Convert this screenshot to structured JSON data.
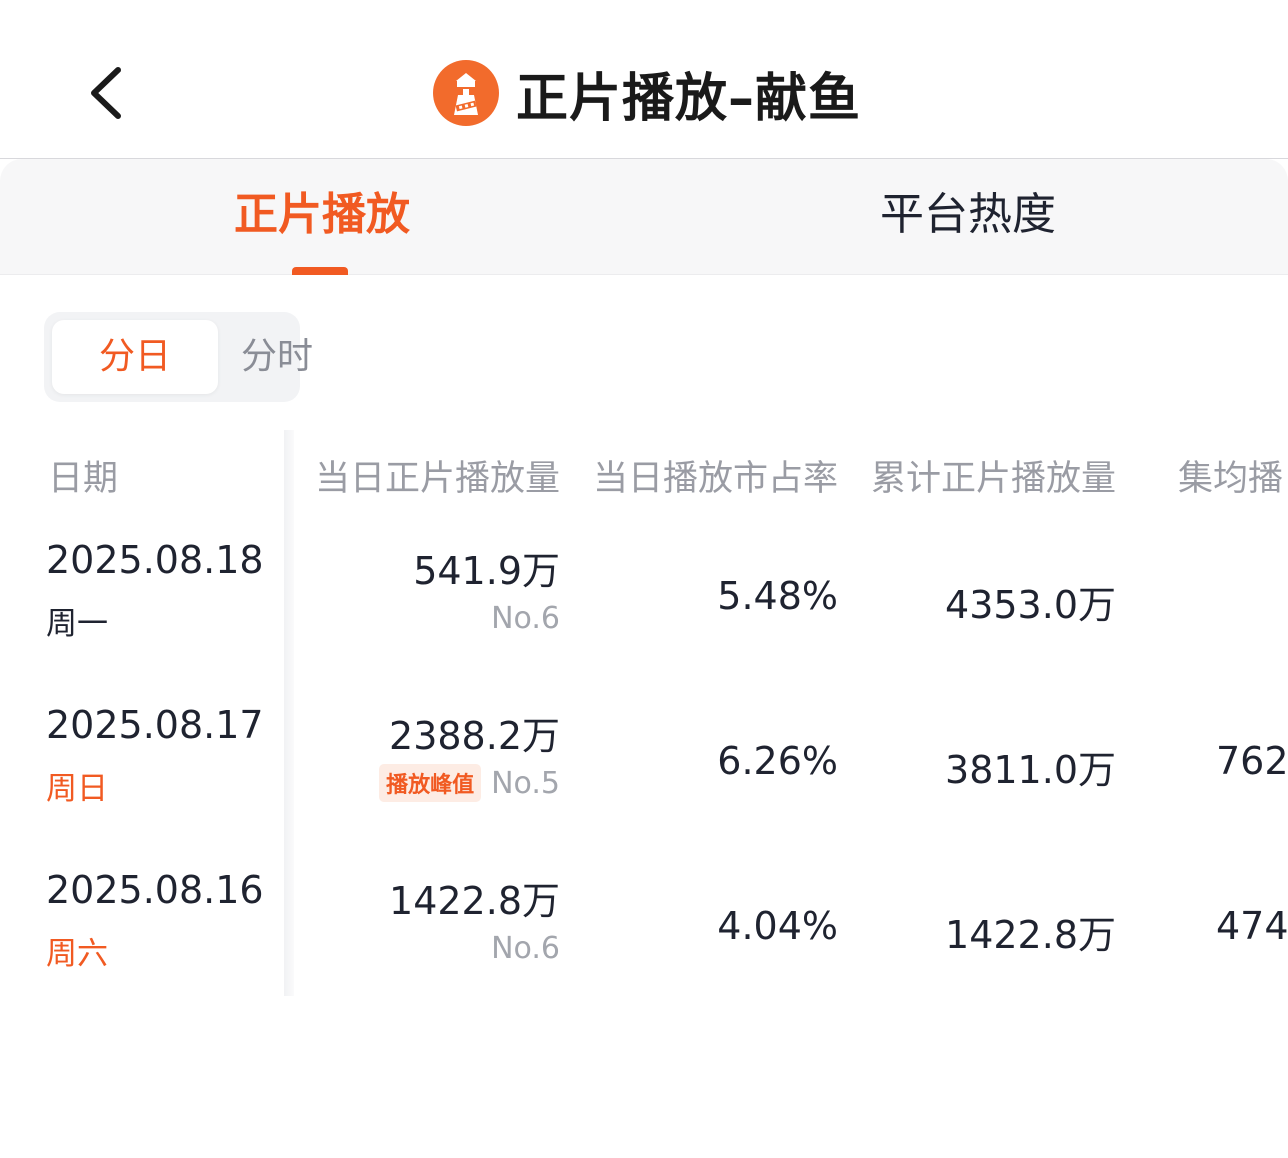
{
  "header": {
    "title": "正片播放–献鱼",
    "back_icon": "chevron-left-icon",
    "logo_icon": "lighthouse-film-logo"
  },
  "tabs": [
    {
      "label": "正片播放",
      "active": true
    },
    {
      "label": "平台热度",
      "active": false
    }
  ],
  "segmented": {
    "options": [
      {
        "label": "分日",
        "active": true
      },
      {
        "label": "分时",
        "active": false
      }
    ]
  },
  "table": {
    "columns": [
      "日期",
      "当日正片播放量",
      "当日播放市占率",
      "累计正片播放量",
      "集均播"
    ],
    "rows": [
      {
        "date": "2025.08.18",
        "weekday": "周一",
        "weekend": false,
        "daily": "541.9万",
        "peak_badge": "",
        "rank": "No.6",
        "share": "5.48%",
        "cumulative": "4353.0万",
        "avg": ""
      },
      {
        "date": "2025.08.17",
        "weekday": "周日",
        "weekend": true,
        "daily": "2388.2万",
        "peak_badge": "播放峰值",
        "rank": "No.5",
        "share": "6.26%",
        "cumulative": "3811.0万",
        "avg": "762."
      },
      {
        "date": "2025.08.16",
        "weekday": "周六",
        "weekend": true,
        "daily": "1422.8万",
        "peak_badge": "",
        "rank": "No.6",
        "share": "4.04%",
        "cumulative": "1422.8万",
        "avg": "474."
      }
    ]
  },
  "colors": {
    "accent": "#f15a22",
    "text": "#1f2330",
    "muted": "#9a9ca4",
    "badge_bg": "#fdece4"
  }
}
